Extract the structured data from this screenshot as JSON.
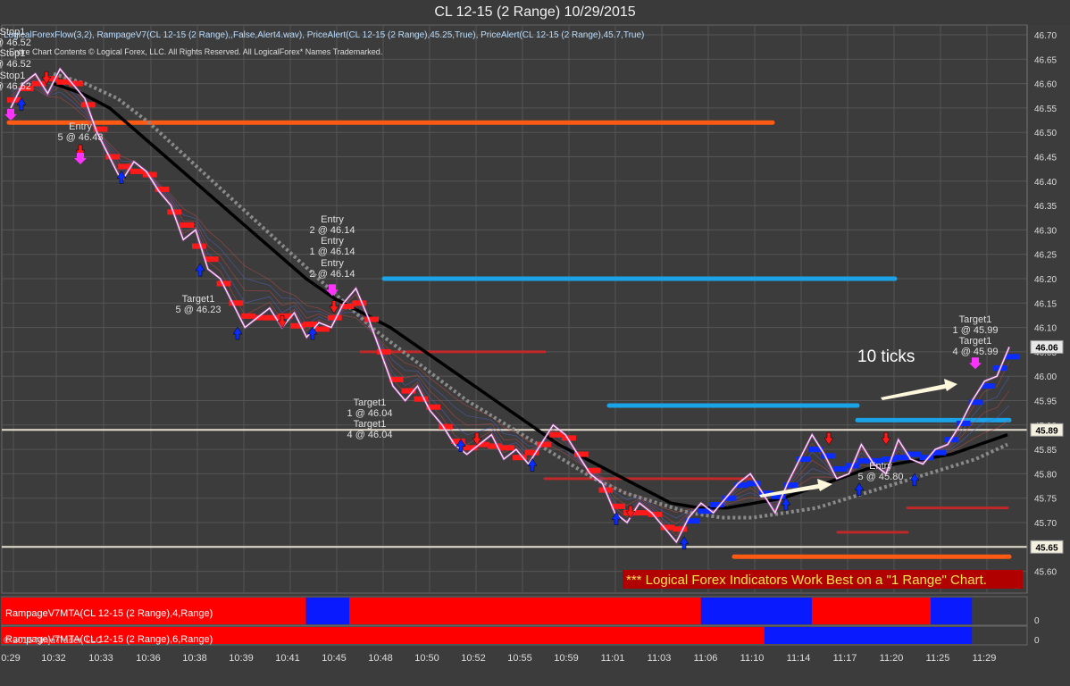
{
  "title": "CL 12-15 (2 Range)  10/29/2015",
  "indicator_line": "LogicalForexFlow(3,2), RampageV7(CL 12-15 (2 Range),,False,Alert4.wav), PriceAlert(CL 12-15 (2 Range),45.25,True), PriceAlert(CL 12-15 (2 Range),45.7,True)",
  "copyright": "Entire Chart Contents © Logical Forex, LLC. All Rights Reserved. All LogicalForex* Names Trademarked.",
  "watermark": "© 2015 NinjaTrader, LLC",
  "banner": "*** Logical Forex Indicators Work Best on a \"1 Range\" Chart.",
  "ticks_note": "10 ticks",
  "colors": {
    "background": "#3c3c3c",
    "grid": "#555555",
    "price_line": "#ffffff",
    "bull": "#0a2cff",
    "bear": "#ff1a1a",
    "alert_marker": "#ff33ff",
    "black_ma": "#000000",
    "gray_ma": "#8a8a8a",
    "banner_text": "#ffe14a",
    "banner_bg": "#b00000",
    "orange_level": "#ff5a14",
    "blue_level": "#1aa3e6",
    "red_level": "#c0282a"
  },
  "chart_data": {
    "type": "line",
    "title": "CL 12-15 (2 Range)  10/29/2015",
    "ylim": [
      45.55,
      46.72
    ],
    "y_ticks": [
      "46.70",
      "46.65",
      "46.60",
      "46.55",
      "46.50",
      "46.45",
      "46.40",
      "46.35",
      "46.30",
      "46.25",
      "46.20",
      "46.15",
      "46.10",
      "46.05",
      "46.00",
      "45.95",
      "45.90",
      "45.85",
      "45.80",
      "45.75",
      "45.70",
      "45.65",
      "45.60"
    ],
    "x_ticks": [
      "0:29",
      "10:32",
      "10:33",
      "10:36",
      "10:38",
      "10:39",
      "10:41",
      "10:45",
      "10:48",
      "10:50",
      "10:52",
      "10:55",
      "10:59",
      "11:01",
      "11:03",
      "11:06",
      "11:10",
      "11:14",
      "11:17",
      "11:20",
      "11:25",
      "11:29"
    ],
    "price_labels": [
      "46.06",
      "45.89",
      "45.65"
    ],
    "horizontal_lines": [
      45.89,
      45.65
    ],
    "series": [
      {
        "name": "price",
        "values": [
          46.55,
          46.6,
          46.62,
          46.58,
          46.63,
          46.6,
          46.57,
          46.5,
          46.45,
          46.4,
          46.44,
          46.42,
          46.38,
          46.35,
          46.28,
          46.3,
          46.22,
          46.2,
          46.15,
          46.1,
          46.12,
          46.14,
          46.1,
          46.13,
          46.08,
          46.11,
          46.1,
          46.15,
          46.18,
          46.12,
          46.05,
          45.98,
          45.95,
          45.98,
          45.93,
          45.9,
          45.86,
          45.84,
          45.86,
          45.88,
          45.83,
          45.85,
          45.82,
          45.86,
          45.9,
          45.88,
          45.84,
          45.8,
          45.78,
          45.72,
          45.7,
          45.74,
          45.72,
          45.69,
          45.66,
          45.71,
          45.74,
          45.72,
          45.75,
          45.78,
          45.8,
          45.76,
          45.72,
          45.78,
          45.83,
          45.88,
          45.84,
          45.79,
          45.8,
          45.86,
          45.82,
          45.8,
          45.87,
          45.83,
          45.82,
          45.85,
          45.86,
          45.9,
          45.95,
          45.99,
          46.0,
          46.06
        ]
      },
      {
        "name": "black-ma",
        "values": [
          46.6,
          46.58,
          46.55,
          46.5,
          46.45,
          46.4,
          46.35,
          46.3,
          46.25,
          46.2,
          46.16,
          46.13,
          46.1,
          46.06,
          46.02,
          45.98,
          45.94,
          45.9,
          45.86,
          45.83,
          45.8,
          45.77,
          45.74,
          45.73,
          45.73,
          45.74,
          45.75,
          45.77,
          45.79,
          45.81,
          45.82,
          45.83,
          45.84,
          45.86,
          45.88
        ]
      },
      {
        "name": "gray-ma",
        "values": [
          46.62,
          46.6,
          46.57,
          46.52,
          46.46,
          46.4,
          46.34,
          46.28,
          46.22,
          46.16,
          46.1,
          46.05,
          46.0,
          45.95,
          45.91,
          45.87,
          45.83,
          45.79,
          45.76,
          45.74,
          45.72,
          45.71,
          45.71,
          45.72,
          45.73,
          45.75,
          45.77,
          45.79,
          45.81,
          45.83,
          45.86
        ]
      }
    ],
    "entry_labels": [
      {
        "line1": "Entry",
        "line2": "5 @ 46.43"
      },
      {
        "line1": "Entry",
        "line2": "2 @ 46.14"
      },
      {
        "line1": "Entry",
        "line2": "1 @ 46.14"
      },
      {
        "line1": "Entry",
        "line2": "2 @ 46.14"
      },
      {
        "line1": "Entry",
        "line2": "5 @ 45.80"
      }
    ],
    "target_labels": [
      {
        "line1": "Target1",
        "line2": "5 @ 46.23"
      },
      {
        "line1": "Target1",
        "line2": "1 @ 46.04"
      },
      {
        "line1": "Target1",
        "line2": "4 @ 46.04"
      },
      {
        "line1": "Target1",
        "line2": "1 @ 45.99"
      },
      {
        "line1": "Target1",
        "line2": "4 @ 45.99"
      }
    ],
    "stop_labels": [
      {
        "line1": "Stop1",
        "line2": "@ 46.52"
      },
      {
        "line1": "Stop1",
        "line2": "@ 46.52"
      },
      {
        "line1": "Stop1",
        "line2": "@ 46.52"
      }
    ],
    "level_lines": [
      {
        "color": "orange",
        "price": 46.52
      },
      {
        "color": "blue",
        "price": 46.2
      },
      {
        "color": "red",
        "price": 46.05
      },
      {
        "color": "blue",
        "price": 45.94
      },
      {
        "color": "blue",
        "price": 45.91
      },
      {
        "color": "red",
        "price": 45.79
      },
      {
        "color": "red",
        "price": 45.73
      },
      {
        "color": "red",
        "price": 45.68
      },
      {
        "color": "orange",
        "price": 45.63
      }
    ],
    "panels": [
      {
        "label": "RampageV7MTA(CL 12-15 (2 Range),4,Range)",
        "axis_value": "0",
        "segments": [
          [
            "red",
            0.0,
            0.302
          ],
          [
            "blue",
            0.302,
            0.345
          ],
          [
            "red",
            0.345,
            0.694
          ],
          [
            "blue",
            0.694,
            0.804
          ],
          [
            "red",
            0.804,
            0.922
          ],
          [
            "blue",
            0.922,
            0.963
          ]
        ]
      },
      {
        "label": "RampageV7MTA(CL 12-15 (2 Range),6,Range)",
        "axis_value": "0",
        "segments": [
          [
            "red",
            0.0,
            0.757
          ],
          [
            "blue",
            0.757,
            0.963
          ]
        ]
      }
    ]
  }
}
